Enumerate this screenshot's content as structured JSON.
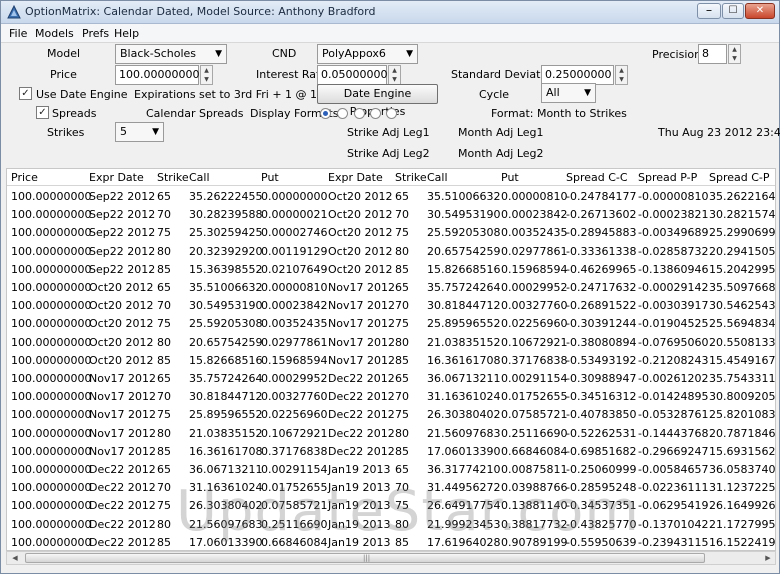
{
  "window": {
    "title": "OptionMatrix: Calendar Dated, Model Source: Anthony Bradford",
    "min_glyph": "⎯",
    "max_glyph": "☐",
    "close_glyph": "✕"
  },
  "menu": {
    "items": [
      "File",
      "Models",
      "Prefs",
      "Help"
    ]
  },
  "controls": {
    "model_label": "Model",
    "model_value": "Black-Scholes",
    "cnd_label": "CND",
    "cnd_value": "PolyAppox6",
    "precision_label": "Precision",
    "precision_value": "8",
    "price_label": "Price",
    "price_value": "100.00000000",
    "rate_label": "Interest Rate",
    "rate_value": "0.05000000",
    "stddev_label": "Standard Deviation",
    "stddev_value": "0.25000000",
    "use_date_engine_label": "Use Date Engine",
    "use_date_engine_checked": true,
    "expirations_text": "Expirations set to 3rd Fri + 1 @ 11:59:00",
    "date_engine_button": "Date Engine Properties",
    "cycle_label": "Cycle",
    "cycle_value": "All",
    "spreads_label": "Spreads",
    "spreads_checked": true,
    "calendar_spreads_label": "Calendar Spreads",
    "display_formats_label": "Display Formats",
    "format_text": "Format: Month to Strikes",
    "strikes_label": "Strikes",
    "strikes_value": "5",
    "strike_adj_leg1": "Strike Adj Leg1",
    "month_adj_leg1": "Month Adj Leg1",
    "strike_adj_leg2": "Strike Adj Leg2",
    "month_adj_leg2": "Month Adj Leg2",
    "timestamp": "Thu Aug 23 2012 23:45:28"
  },
  "grid": {
    "columns": [
      "Price",
      "Expr Date",
      "Strike",
      "Call",
      "Put",
      "Expr Date",
      "Strike",
      "Call",
      "Put",
      "Spread C-C",
      "Spread P-P",
      "Spread C-P"
    ],
    "rows": [
      [
        "100.00000000",
        "Sep22 2012",
        "65",
        "35.26222455",
        "0.00000000",
        "Oct20 2012",
        "65",
        "35.51006632",
        "0.00000810",
        "-0.24784177",
        "-0.00000810",
        "35.26221645"
      ],
      [
        "100.00000000",
        "Sep22 2012",
        "70",
        "30.28239588",
        "0.00000021",
        "Oct20 2012",
        "70",
        "30.54953190",
        "0.00023842",
        "-0.26713602",
        "-0.00023821",
        "30.28215746"
      ],
      [
        "100.00000000",
        "Sep22 2012",
        "75",
        "25.30259425",
        "0.00002746",
        "Oct20 2012",
        "75",
        "25.59205308",
        "0.00352435",
        "-0.28945883",
        "-0.00349689",
        "25.29906990"
      ],
      [
        "100.00000000",
        "Sep22 2012",
        "80",
        "20.32392920",
        "0.00119129",
        "Oct20 2012",
        "80",
        "20.65754259",
        "0.02977861",
        "-0.33361338",
        "-0.02858732",
        "20.29415059"
      ],
      [
        "100.00000000",
        "Sep22 2012",
        "85",
        "15.36398552",
        "0.02107649",
        "Oct20 2012",
        "85",
        "15.82668516",
        "0.15968594",
        "-0.46269965",
        "-0.13860946",
        "15.20429957"
      ],
      [
        "100.00000000",
        "Oct20 2012",
        "65",
        "35.51006632",
        "0.00000810",
        "Nov17 2012",
        "65",
        "35.75724264",
        "0.00029952",
        "-0.24717632",
        "-0.00029142",
        "35.50976681"
      ],
      [
        "100.00000000",
        "Oct20 2012",
        "70",
        "30.54953190",
        "0.00023842",
        "Nov17 2012",
        "70",
        "30.81844712",
        "0.00327760",
        "-0.26891522",
        "-0.00303917",
        "30.54625430"
      ],
      [
        "100.00000000",
        "Oct20 2012",
        "75",
        "25.59205308",
        "0.00352435",
        "Nov17 2012",
        "75",
        "25.89596552",
        "0.02256960",
        "-0.30391244",
        "-0.01904525",
        "25.56948347"
      ],
      [
        "100.00000000",
        "Oct20 2012",
        "80",
        "20.65754259",
        "0.02977861",
        "Nov17 2012",
        "80",
        "21.03835152",
        "0.10672921",
        "-0.38080894",
        "-0.07695060",
        "20.55081337"
      ],
      [
        "100.00000000",
        "Oct20 2012",
        "85",
        "15.82668516",
        "0.15968594",
        "Nov17 2012",
        "85",
        "16.36161708",
        "0.37176838",
        "-0.53493192",
        "-0.21208243",
        "15.45491678"
      ],
      [
        "100.00000000",
        "Nov17 2012",
        "65",
        "35.75724264",
        "0.00029952",
        "Dec22 2012",
        "65",
        "36.06713211",
        "0.00291154",
        "-0.30988947",
        "-0.00261202",
        "35.75433110"
      ],
      [
        "100.00000000",
        "Nov17 2012",
        "70",
        "30.81844712",
        "0.00327760",
        "Dec22 2012",
        "70",
        "31.16361024",
        "0.01752655",
        "-0.34516312",
        "-0.01424895",
        "30.80092057"
      ],
      [
        "100.00000000",
        "Nov17 2012",
        "75",
        "25.89596552",
        "0.02256960",
        "Dec22 2012",
        "75",
        "26.30380402",
        "0.07585721",
        "-0.40783850",
        "-0.05328761",
        "25.82010831"
      ],
      [
        "100.00000000",
        "Nov17 2012",
        "80",
        "21.03835152",
        "0.10672921",
        "Dec22 2012",
        "80",
        "21.56097683",
        "0.25116690",
        "-0.52262531",
        "-0.14443768",
        "20.78718462"
      ],
      [
        "100.00000000",
        "Nov17 2012",
        "85",
        "16.36161708",
        "0.37176838",
        "Dec22 2012",
        "85",
        "17.06013390",
        "0.66846084",
        "-0.69851682",
        "-0.29669247",
        "15.69315624"
      ],
      [
        "100.00000000",
        "Dec22 2012",
        "65",
        "36.06713211",
        "0.00291154",
        "Jan19 2013",
        "65",
        "36.31774210",
        "0.00875811",
        "-0.25060999",
        "-0.00584657",
        "36.05837400"
      ],
      [
        "100.00000000",
        "Dec22 2012",
        "70",
        "31.16361024",
        "0.01752655",
        "Jan19 2013",
        "70",
        "31.44956272",
        "0.03988766",
        "-0.28595248",
        "-0.02236111",
        "31.12372259"
      ],
      [
        "100.00000000",
        "Dec22 2012",
        "75",
        "26.30380402",
        "0.07585721",
        "Jan19 2013",
        "75",
        "26.64917754",
        "0.13881140",
        "-0.34537351",
        "-0.06295419",
        "26.16499262"
      ],
      [
        "100.00000000",
        "Dec22 2012",
        "80",
        "21.56097683",
        "0.25116690",
        "Jan19 2013",
        "80",
        "21.99923453",
        "0.38817732",
        "-0.43825770",
        "-0.13701042",
        "21.17279951"
      ],
      [
        "100.00000000",
        "Dec22 2012",
        "85",
        "17.06013390",
        "0.66846084",
        "Jan19 2013",
        "85",
        "17.61964028",
        "0.90789199",
        "-0.55950639",
        "-0.23943115",
        "16.15224190"
      ]
    ]
  },
  "scrollbar": {
    "left_glyph": "◀",
    "right_glyph": "▶",
    "grip_glyph": "|||"
  },
  "watermark": "UpdateStar.com"
}
